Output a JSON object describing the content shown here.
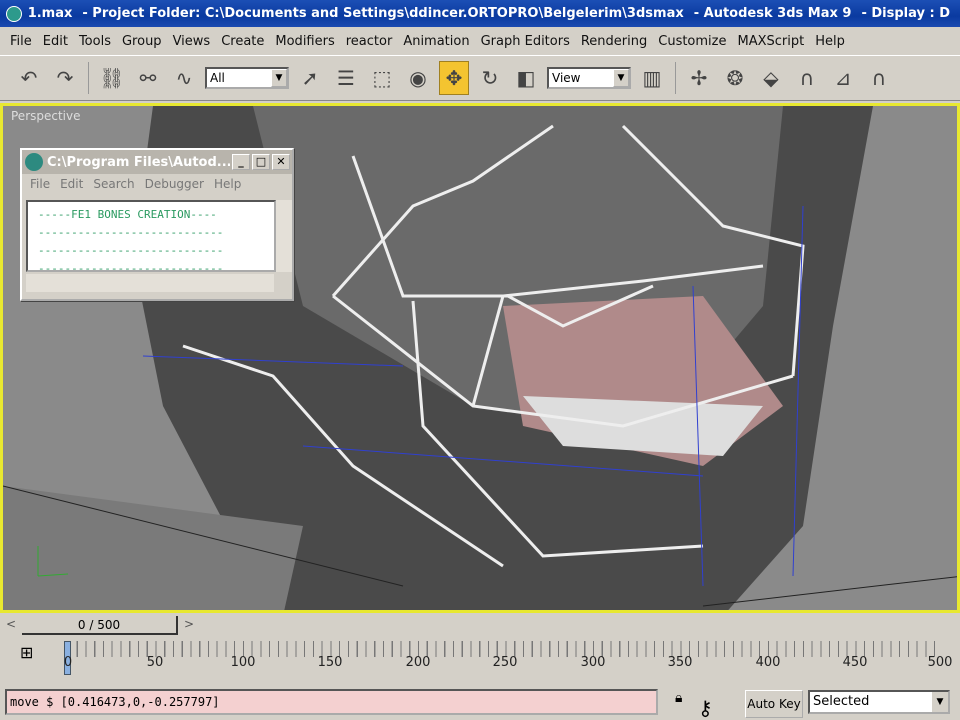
{
  "title": {
    "file": "1.max",
    "project": "- Project Folder: C:\\Documents and Settings\\ddincer.ORTOPRO\\Belgelerim\\3dsmax",
    "app": "- Autodesk 3ds Max 9",
    "display": "- Display : D"
  },
  "menu": [
    "File",
    "Edit",
    "Tools",
    "Group",
    "Views",
    "Create",
    "Modifiers",
    "reactor",
    "Animation",
    "Graph Editors",
    "Rendering",
    "Customize",
    "MAXScript",
    "Help"
  ],
  "toolbar": {
    "selection_filter": "All",
    "ref_coord": "View"
  },
  "viewport": {
    "label": "Perspective"
  },
  "dialog": {
    "title": "C:\\Program Files\\Autod...",
    "menu": [
      "File",
      "Edit",
      "Search",
      "Debugger",
      "Help"
    ],
    "lines": [
      "-----FE1 BONES CREATION----",
      "----------------------------",
      "----------------------------",
      "----------------------------"
    ]
  },
  "time_slider": {
    "label": "0 / 500",
    "prev": "<",
    "next": ">"
  },
  "track": {
    "ticks": [
      "0",
      "50",
      "100",
      "150",
      "200",
      "250",
      "300",
      "350",
      "400",
      "450",
      "500"
    ]
  },
  "bottom": {
    "listener": "move $ [0.416473,0,-0.257797]",
    "auto_key": "Auto Key",
    "key_filter": "Selected"
  }
}
